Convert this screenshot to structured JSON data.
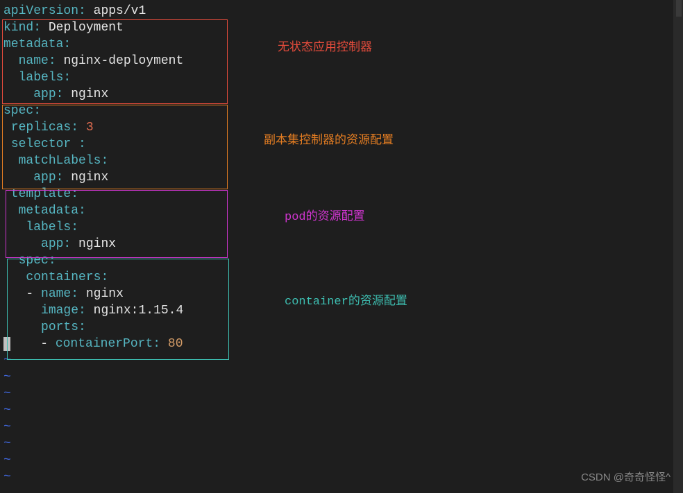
{
  "yaml": {
    "line1": {
      "key": "apiVersion",
      "value": "apps/v1"
    },
    "line2": {
      "key": "kind",
      "value": "Deployment"
    },
    "line3": {
      "key": "metadata"
    },
    "line4": {
      "key": "name",
      "value": "nginx-deployment"
    },
    "line5": {
      "key": "labels"
    },
    "line6": {
      "key": "app",
      "value": "nginx"
    },
    "line7": {
      "key": "spec"
    },
    "line8": {
      "key": "replicas",
      "value": "3"
    },
    "line9": {
      "key": "selector "
    },
    "line10": {
      "key": "matchLabels"
    },
    "line11": {
      "key": "app",
      "value": "nginx"
    },
    "line12": {
      "key": "template"
    },
    "line13": {
      "key": "metadata"
    },
    "line14": {
      "key": "labels"
    },
    "line15": {
      "key": "app",
      "value": "nginx"
    },
    "line16": {
      "key": "spec"
    },
    "line17": {
      "key": "containers"
    },
    "line18": {
      "dash": "- ",
      "key": "name",
      "value": "nginx"
    },
    "line19": {
      "key": "image",
      "value": "nginx:1.15.4"
    },
    "line20": {
      "key": "ports"
    },
    "line21": {
      "dash": "- ",
      "key": "containerPort",
      "value": "80"
    }
  },
  "annotations": {
    "red": "无状态应用控制器",
    "orange": "副本集控制器的资源配置",
    "magenta": "pod的资源配置",
    "cyan": "container的资源配置"
  },
  "tilde": "~",
  "watermark": "CSDN @奇奇怪怪^"
}
